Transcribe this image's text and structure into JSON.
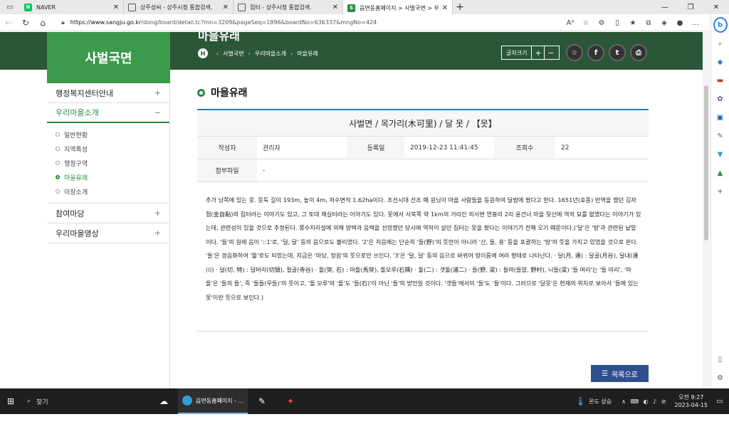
{
  "browser": {
    "tabs": [
      {
        "label": "NAVER",
        "favicon_color": "#03c75a",
        "favicon_text": "N"
      },
      {
        "label": "상주성씨 - 상주시청 통합검색.",
        "favicon_color": "",
        "favicon_text": ""
      },
      {
        "label": "집터 - 상주시청 통합검색.",
        "favicon_color": "",
        "favicon_text": ""
      },
      {
        "label": "읍면동홈페이지 > 사벌국면 > 우",
        "favicon_color": "#2b8a3e",
        "favicon_text": "S"
      }
    ],
    "new_tab": "+",
    "url_host": "https://www.sangju.go.kr",
    "url_path": "/dong/board/detail.tc?mn=3209&pageSeq=1896&boardNo=636337&mngNo=424",
    "window_controls": [
      "—",
      "❐",
      "✕"
    ]
  },
  "header": {
    "site_name": "사벌국면",
    "page_title": "마을유래",
    "breadcrumb": [
      "사벌국면",
      "우리마을소개",
      "마을유래"
    ],
    "font_size_label": "글자크기",
    "font_plus": "+",
    "font_minus": "−"
  },
  "sidebar": {
    "items": [
      {
        "label": "행정복지센터안내",
        "sign": "+"
      },
      {
        "label": "우리마을소개",
        "sign": "−"
      },
      {
        "label": "참여마당",
        "sign": "+"
      },
      {
        "label": "우리마을영상",
        "sign": "+"
      }
    ],
    "sub_items": [
      "일반현황",
      "지역특성",
      "행정구역",
      "마을유래",
      "이장소개"
    ]
  },
  "post": {
    "section_title": "마을유래",
    "title": "사벌면 / 목가리(木可里) / 달 못 / 【못】",
    "author_label": "작성자",
    "author": "관리자",
    "date_label": "등록일",
    "date": "2019-12-23 11:41:45",
    "views_label": "조회수",
    "views": "22",
    "attach_label": "첨부파일",
    "attach": "-",
    "body": "추가 남쪽에 있는 못. 못둑 길이 193m, 높이 4m, 저수면적 1.62ha이다. 조선시대 선조 때 원님이 마을 사람들을 동원하여 달밤에 팠다고 한다. 1651년(효종) 반역을 했던 김자점(金自點)의 집터라는 이야기도 있고, 그 토대 재실터라는 이야기도 있다. 못에서 서북쪽 약 1km의 거리인 외서면 연봉리 2리 윤건너 마을 뒷산에 역적 묘를 없앴다는 이야기가 있는데, 관련성이 있을 것으로 추정된다. 풍수지리설에 의해 양택과 음택을 선정했던 당시에 역적이 살던 집터는 못을 팠다는 이야기가 전해 오기 때문이다.('달'은 '땅'과 관련된 낱말이다. '들'의 원래 음이 '::1'로, '덜, 달' 등의 음으로도 불리었다. '2'은 처음에는 단순히 '들(野)'의 뜻만이 아니라 '산, 들, 용' 등을 포괄하는 '땅'의 뜻을 가지고 있었을 것으로 본다. '들'은 경음화하여 '뜰'로도 되었는데, 지금은 '마당, 정원'의 뜻으로만 쓰인다. '3'은 '달, 덜' 등의 음으로 바뀌어 땅이름에 여러 형태로 나타난다. · 달(月, 達) : 달골(月谷), 달내(達川) · 덜(切, 特) : 덜머리(切頭), 절골(寺谷) · 돌(突, 石) : 마돌(馬突), 돌모루(石隅) · 둘(二) : 갯둘(浦二) · 들(野, 梁) : 들마(들말, 野村), 너들(梁) '들 머리'는 '들 미리', '마 돌'은 '들의 들', 즉 '들들(무들)'의 뜻이고, '돌 모루'의 '돌'도 '들(石)'이 아닌 '들'의 방언일 것이다. '갯들'에서의 '들'도 '들'이다. 그러므로 '달못'은 현재의 위치로 보아서 '들에 있는 못'이란 뜻으로 보인다.)",
    "list_button": "목록으로"
  },
  "taskbar": {
    "search_label": "찾기",
    "edge_label": "읍면동홈페이지 - ...",
    "weather": "온도 상승",
    "time": "오전 9:27",
    "date": "2023-04-15"
  },
  "colors": {
    "banner_dark": "#2b5637",
    "banner_side": "#3c9a4c",
    "accent_green": "#2b8a3e",
    "board_border": "#2b7bb9",
    "list_button": "#2d4f8e"
  }
}
